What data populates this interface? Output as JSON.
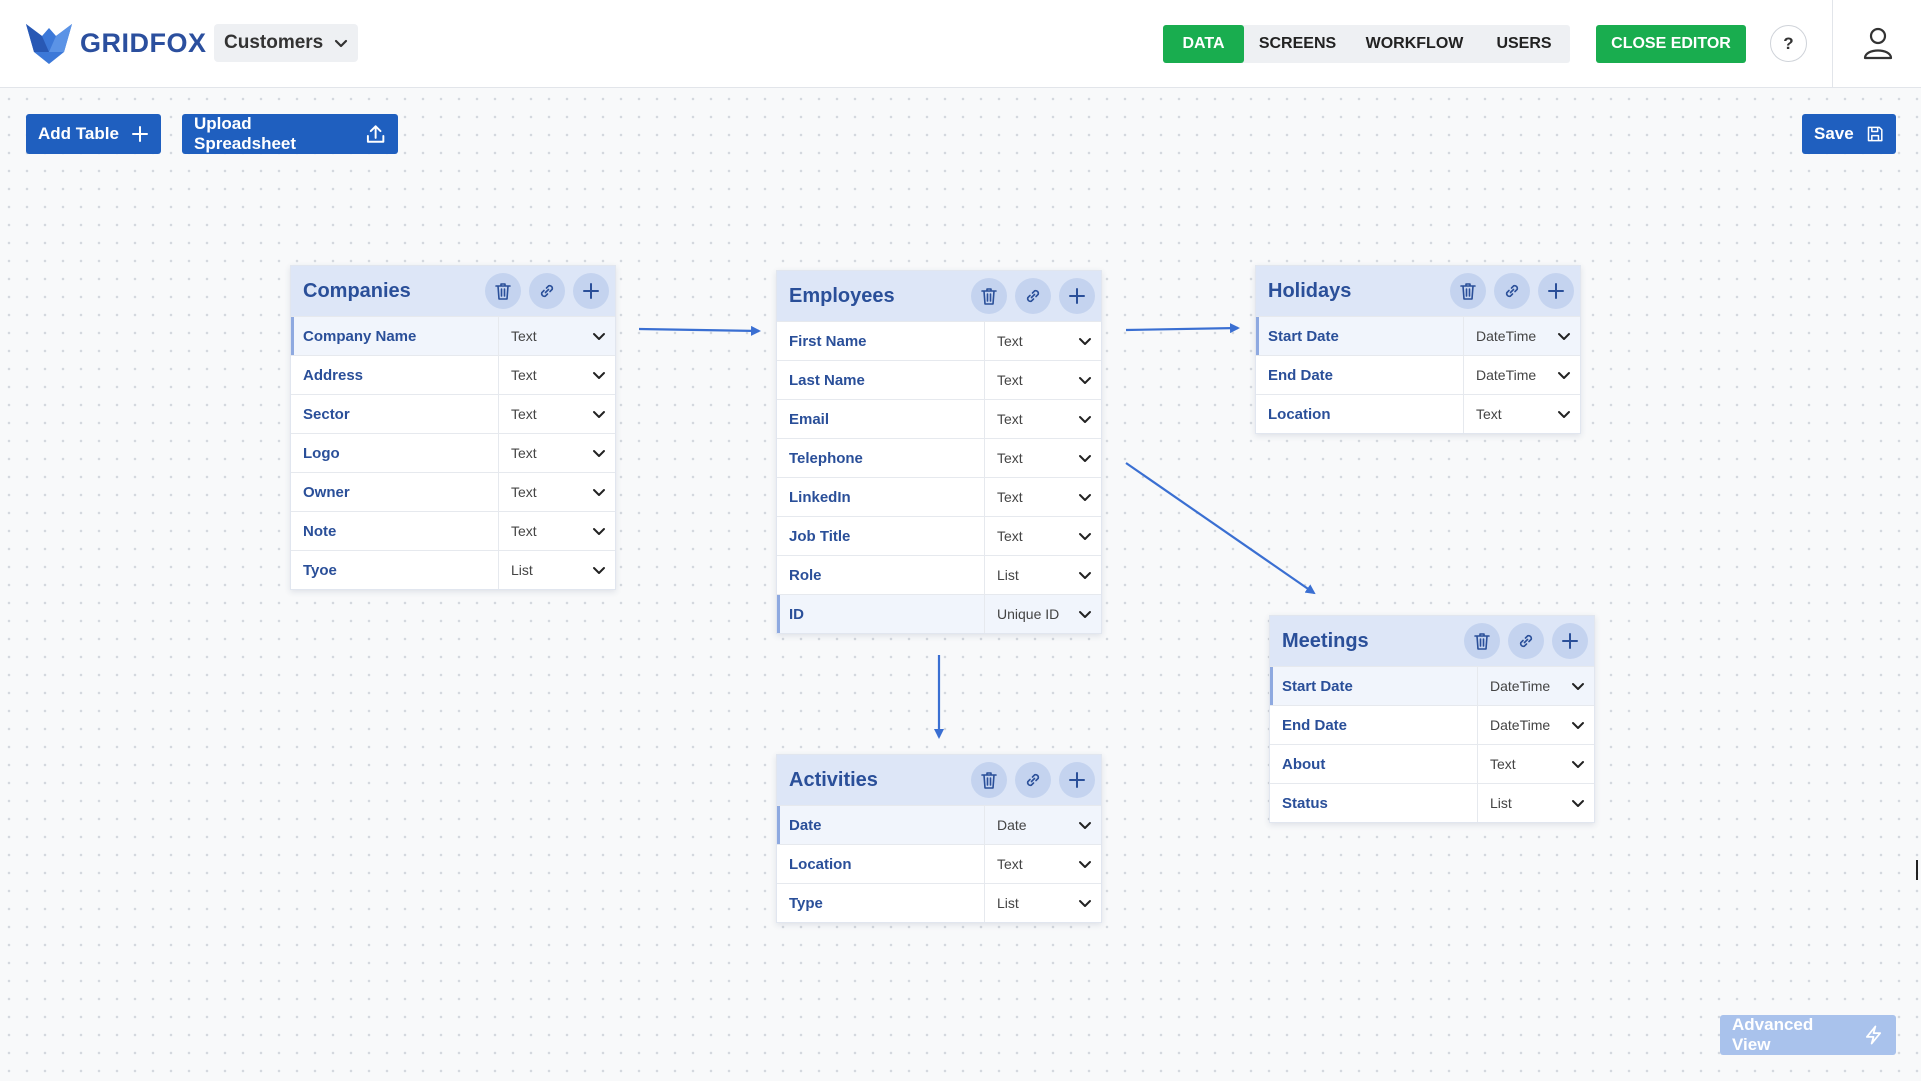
{
  "header": {
    "logo_text": "GRIDFOX",
    "project": "Customers",
    "nav": [
      "DATA",
      "SCREENS",
      "WORKFLOW",
      "USERS"
    ],
    "active_nav": "DATA",
    "close_editor": "CLOSE EDITOR",
    "help": "?"
  },
  "toolbar": {
    "add_table": "Add Table",
    "upload_spreadsheet": "Upload Spreadsheet",
    "save": "Save",
    "advanced_view": "Advanced View"
  },
  "colors": {
    "brand_blue": "#1f5fbf",
    "brand_green": "#19ad4f",
    "table_header": "#dde6f7",
    "field_text": "#2a4f99"
  },
  "icons": [
    "fox-logo-icon",
    "chevron-down-icon",
    "question-icon",
    "user-icon",
    "plus-icon",
    "upload-icon",
    "save-icon",
    "lightning-icon",
    "trash-icon",
    "link-icon"
  ],
  "tables": {
    "companies": {
      "title": "Companies",
      "fields": [
        {
          "name": "Company Name",
          "type": "Text"
        },
        {
          "name": "Address",
          "type": "Text"
        },
        {
          "name": "Sector",
          "type": "Text"
        },
        {
          "name": "Logo",
          "type": "Text"
        },
        {
          "name": "Owner",
          "type": "Text"
        },
        {
          "name": "Note",
          "type": "Text"
        },
        {
          "name": "Tyoe",
          "type": "List"
        }
      ]
    },
    "employees": {
      "title": "Employees",
      "fields": [
        {
          "name": "First Name",
          "type": "Text"
        },
        {
          "name": "Last Name",
          "type": "Text"
        },
        {
          "name": "Email",
          "type": "Text"
        },
        {
          "name": "Telephone",
          "type": "Text"
        },
        {
          "name": "LinkedIn",
          "type": "Text"
        },
        {
          "name": "Job Title",
          "type": "Text"
        },
        {
          "name": "Role",
          "type": "List"
        },
        {
          "name": "ID",
          "type": "Unique ID"
        }
      ]
    },
    "holidays": {
      "title": "Holidays",
      "fields": [
        {
          "name": "Start Date",
          "type": "DateTime"
        },
        {
          "name": "End Date",
          "type": "DateTime"
        },
        {
          "name": "Location",
          "type": "Text"
        }
      ]
    },
    "activities": {
      "title": "Activities",
      "fields": [
        {
          "name": "Date",
          "type": "Date"
        },
        {
          "name": "Location",
          "type": "Text"
        },
        {
          "name": "Type",
          "type": "List"
        }
      ]
    },
    "meetings": {
      "title": "Meetings",
      "fields": [
        {
          "name": "Start Date",
          "type": "DateTime"
        },
        {
          "name": "End Date",
          "type": "DateTime"
        },
        {
          "name": "About",
          "type": "Text"
        },
        {
          "name": "Status",
          "type": "List"
        }
      ]
    }
  }
}
